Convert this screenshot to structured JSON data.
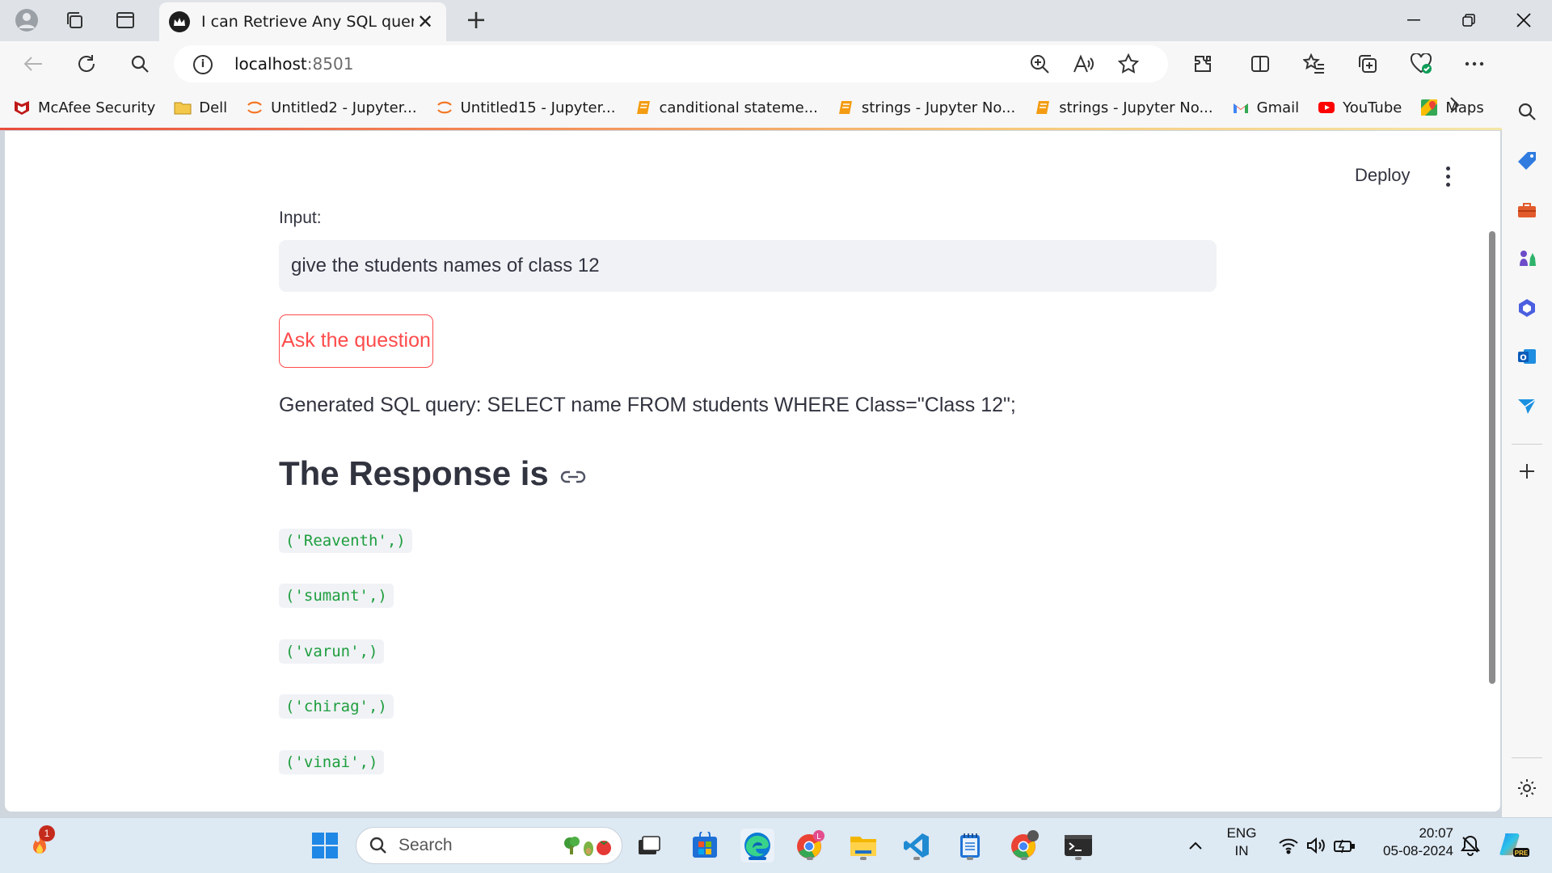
{
  "browser": {
    "tab_title": "I can Retrieve Any SQL query",
    "tab_close": "✕",
    "new_tab": "+",
    "url_host": "localhost",
    "url_port": ":8501",
    "bookmarks": [
      {
        "label": "McAfee Security",
        "icon": "mcafee-icon",
        "color": "#c01818"
      },
      {
        "label": "Dell",
        "icon": "folder-icon",
        "color": "#f3c84b"
      },
      {
        "label": "Untitled2 - Jupyter...",
        "icon": "jupyter-icon",
        "color": "#f37726"
      },
      {
        "label": "Untitled15 - Jupyter...",
        "icon": "jupyter-icon",
        "color": "#f37726"
      },
      {
        "label": "canditional stateme...",
        "icon": "notebook-icon",
        "color": "#f39c12"
      },
      {
        "label": "strings - Jupyter No...",
        "icon": "notebook-icon",
        "color": "#f39c12"
      },
      {
        "label": "strings - Jupyter No...",
        "icon": "notebook-icon",
        "color": "#f39c12"
      },
      {
        "label": "Gmail",
        "icon": "gmail-icon",
        "color": "#ea4335"
      },
      {
        "label": "YouTube",
        "icon": "youtube-icon",
        "color": "#ff0000"
      },
      {
        "label": "Maps",
        "icon": "maps-icon",
        "color": "#34a853"
      }
    ]
  },
  "app": {
    "deploy_label": "Deploy",
    "input_label": "Input:",
    "input_value": "give the students names of class 12",
    "ask_button": "Ask the question",
    "generated_sql": "Generated SQL query: SELECT name FROM students WHERE Class=\"Class 12\";",
    "response_heading": "The Response is",
    "results": [
      "('Reaventh',)",
      "('sumant',)",
      "('varun',)",
      "('chirag',)",
      "('vinai',)"
    ],
    "accent_color": "#ff4b4b",
    "code_color": "#1e9e3e"
  },
  "taskbar": {
    "search_placeholder": "Search",
    "notification_badge": "1",
    "lang_line1": "ENG",
    "lang_line2": "IN",
    "time": "20:07",
    "date": "05-08-2024"
  }
}
